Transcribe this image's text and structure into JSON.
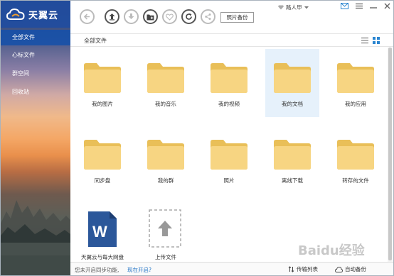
{
  "app": {
    "brand": "天翼云"
  },
  "sidebar": {
    "items": [
      {
        "label": "全部文件"
      },
      {
        "label": "心标文件"
      },
      {
        "label": "群空间"
      },
      {
        "label": "回收站"
      }
    ]
  },
  "toolbar": {
    "backup_label": "照片备份",
    "user_name": "路人甲"
  },
  "breadcrumb": {
    "current": "全部文件"
  },
  "folders": [
    {
      "name": "我的图片"
    },
    {
      "name": "我的音乐"
    },
    {
      "name": "我的视频"
    },
    {
      "name": "我的文档"
    },
    {
      "name": "我的应用"
    },
    {
      "name": "同步盘"
    },
    {
      "name": "我的群"
    },
    {
      "name": "照片"
    },
    {
      "name": "离线下载"
    },
    {
      "name": "转存的文件"
    }
  ],
  "files": [
    {
      "name": "天翼云与每大网盘",
      "icon": "word-document-icon"
    },
    {
      "name": "上传文件",
      "icon": "upload-icon"
    }
  ],
  "status": {
    "hint": "您未开启同步功能,",
    "link": "现在开启?",
    "transfer_label": "传输列表",
    "auto_backup_label": "自动备份"
  },
  "watermark": "Baidu经验",
  "colors": {
    "accent": "#1a6fc4",
    "sidebar_header": "#214da0",
    "folder": "#f5d27a"
  }
}
